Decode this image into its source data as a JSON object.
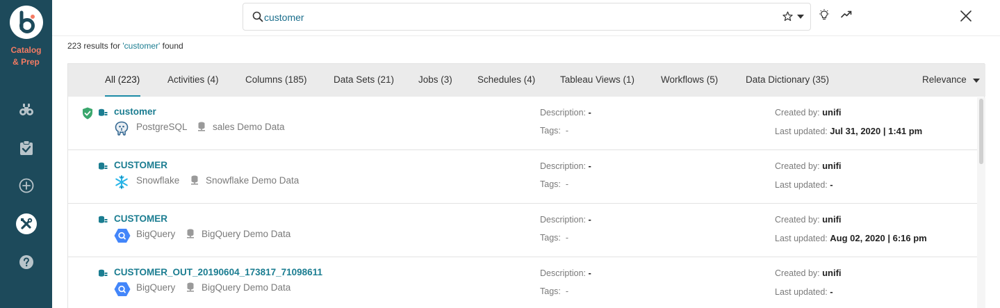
{
  "sidebar": {
    "app_name_line1": "Catalog",
    "app_name_line2": "& Prep",
    "icons": [
      "binoculars-icon",
      "clipboard-check-icon",
      "plus-circle-icon",
      "tools-icon",
      "help-icon"
    ]
  },
  "search": {
    "value": "customer",
    "placeholder": ""
  },
  "summary": {
    "prefix": "223 results for ",
    "query": "'customer'",
    "suffix": " found"
  },
  "tabs": [
    {
      "label": "All (223)",
      "active": true
    },
    {
      "label": "Activities (4)"
    },
    {
      "label": "Columns (185)"
    },
    {
      "label": "Data Sets (21)"
    },
    {
      "label": "Jobs (3)"
    },
    {
      "label": "Schedules (4)"
    },
    {
      "label": "Tableau Views (1)"
    },
    {
      "label": "Workflows (5)"
    },
    {
      "label": "Data Dictionary (35)"
    }
  ],
  "sort": {
    "label": "Relevance"
  },
  "meta_labels": {
    "description": "Description:",
    "tags": "Tags:",
    "created_by": "Created by:",
    "last_updated": "Last updated:"
  },
  "results": [
    {
      "name": "customer",
      "certified": true,
      "source": "PostgreSQL",
      "source_icon": "postgresql-icon",
      "database": "sales Demo Data",
      "description": "-",
      "tags": "-",
      "created_by": "unifi",
      "last_updated": "Jul 31, 2020 | 1:41 pm"
    },
    {
      "name": "CUSTOMER",
      "certified": false,
      "source": "Snowflake",
      "source_icon": "snowflake-icon",
      "database": "Snowflake Demo Data",
      "description": "-",
      "tags": "-",
      "created_by": "unifi",
      "last_updated": "-"
    },
    {
      "name": "CUSTOMER",
      "certified": false,
      "source": "BigQuery",
      "source_icon": "bigquery-icon",
      "database": "BigQuery Demo Data",
      "description": "-",
      "tags": "-",
      "created_by": "unifi",
      "last_updated": "Aug 02, 2020 | 6:16 pm"
    },
    {
      "name": "CUSTOMER_OUT_20190604_173817_71098611",
      "certified": false,
      "source": "BigQuery",
      "source_icon": "bigquery-icon",
      "database": "BigQuery Demo Data",
      "description": "-",
      "tags": "-",
      "created_by": "unifi",
      "last_updated": "-"
    }
  ],
  "colors": {
    "sidebar_bg": "#1d4a5b",
    "brand_accent": "#f47b63",
    "link": "#1b7d91",
    "certified": "#3aa76d"
  }
}
